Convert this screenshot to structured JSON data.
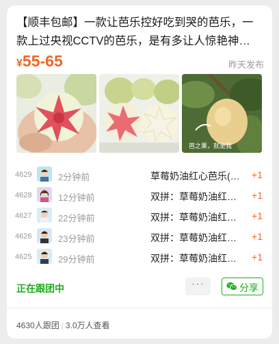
{
  "post": {
    "title": "【顺丰包邮】一款让芭乐控好吃到哭的芭乐，一款上过央视CCTV的芭乐，是有多让人惊艳神…",
    "price_symbol": "¥",
    "price_range": "55-65",
    "posted_time": "昨天发布",
    "image_caption": "芭之果，就是我"
  },
  "orders": [
    {
      "number": "4629",
      "time": "2分钟前",
      "item": "草莓奶油红心芭乐(…",
      "qty": "+1"
    },
    {
      "number": "4628",
      "time": "12分钟前",
      "item": "双拼：草莓奶油红…",
      "qty": "+1"
    },
    {
      "number": "4627",
      "time": "22分钟前",
      "item": "双拼：草莓奶油红…",
      "qty": "+1"
    },
    {
      "number": "4626",
      "time": "23分钟前",
      "item": "双拼：草莓奶油红…",
      "qty": "+1"
    },
    {
      "number": "4625",
      "time": "29分钟前",
      "item": "双拼：草莓奶油红…",
      "qty": "+1"
    }
  ],
  "status_text": "正在跟团中",
  "more_label": "···",
  "share_label": "分享",
  "footer": {
    "participants": "4630人跟团",
    "views": "3.0万人查看"
  },
  "colors": {
    "price": "#f26522",
    "status_green": "#1aad19",
    "muted": "#9a9a9a"
  },
  "icons": {
    "share": "wechat-icon",
    "more": "more-dots-icon"
  }
}
